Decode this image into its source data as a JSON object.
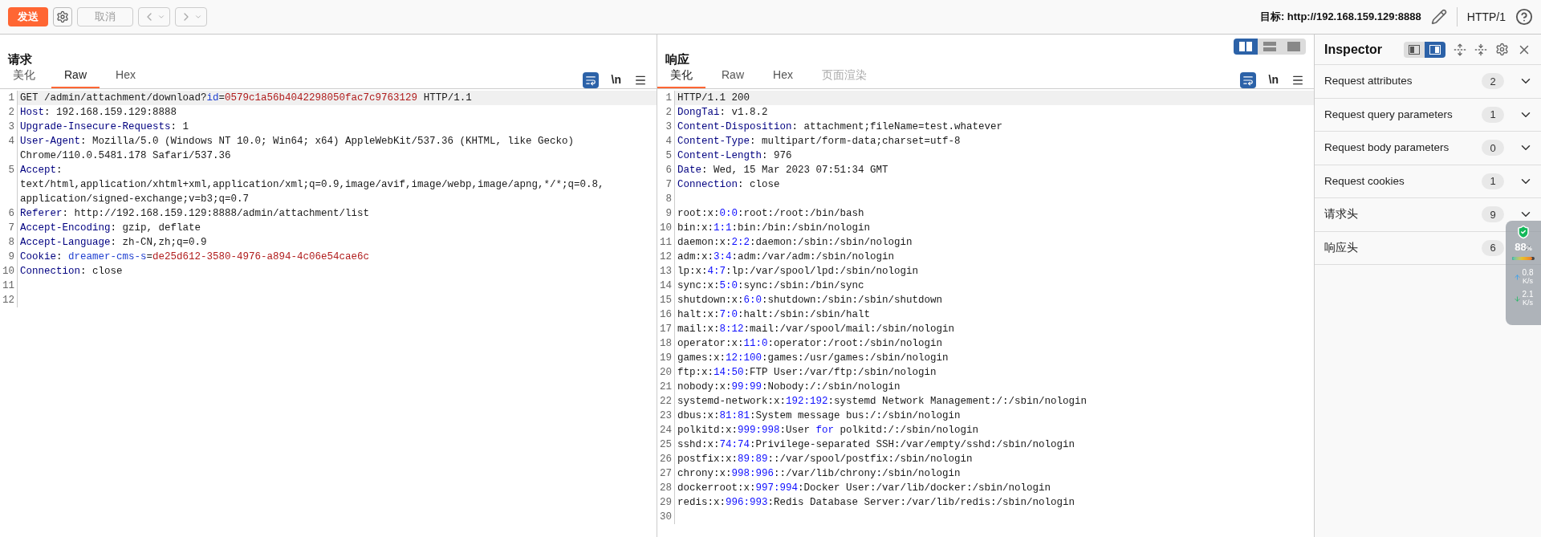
{
  "toolbar": {
    "send": "发送",
    "cancel": "取消",
    "target_label": "目标: ",
    "target_url": "http://192.168.159.129:8888",
    "protocol": "HTTP/1"
  },
  "layout_modes": [
    {
      "kind": "columns",
      "selected": true
    },
    {
      "kind": "rows",
      "selected": false
    },
    {
      "kind": "single",
      "selected": false
    }
  ],
  "request": {
    "title": "请求",
    "newline_toggle": "\\n",
    "tabs": [
      {
        "label": "美化",
        "selected": false,
        "disabled": false
      },
      {
        "label": "Raw",
        "selected": true,
        "disabled": false
      },
      {
        "label": "Hex",
        "selected": false,
        "disabled": false
      }
    ],
    "lines": [
      {
        "number": "1",
        "current": true,
        "parts": [
          {
            "kind": "text",
            "text": "GET /admin/attachment/download?"
          },
          {
            "kind": "param",
            "text": "id"
          },
          {
            "kind": "text",
            "text": "="
          },
          {
            "kind": "value",
            "text": "0579c1a56b4042298050fac7c9763129"
          },
          {
            "kind": "text",
            "text": " HTTP/1.1"
          }
        ]
      },
      {
        "number": "2",
        "current": false,
        "parts": [
          {
            "kind": "header",
            "text": "Host"
          },
          {
            "kind": "text",
            "text": ": 192.168.159.129:8888"
          }
        ]
      },
      {
        "number": "3",
        "current": false,
        "parts": [
          {
            "kind": "header",
            "text": "Upgrade-Insecure-Requests"
          },
          {
            "kind": "text",
            "text": ": 1"
          }
        ]
      },
      {
        "number": "4",
        "current": false,
        "parts": [
          {
            "kind": "header",
            "text": "User-Agent"
          },
          {
            "kind": "text",
            "text": ": Mozilla/5.0 (Windows NT 10.0; Win64; x64) AppleWebKit/537.36 (KHTML, like Gecko)"
          }
        ]
      },
      {
        "current": false,
        "parts": [
          {
            "kind": "text",
            "text": "Chrome/110.0.5481.178 Safari/537.36"
          }
        ]
      },
      {
        "number": "5",
        "current": false,
        "parts": [
          {
            "kind": "header",
            "text": "Accept"
          },
          {
            "kind": "text",
            "text": ":"
          }
        ]
      },
      {
        "current": false,
        "parts": [
          {
            "kind": "text",
            "text": "text/html,application/xhtml+xml,application/xml;q=0.9,image/avif,image/webp,image/apng,*/*;q=0.8,"
          }
        ]
      },
      {
        "current": false,
        "parts": [
          {
            "kind": "text",
            "text": "application/signed-exchange;v=b3;q=0.7"
          }
        ]
      },
      {
        "number": "6",
        "current": false,
        "parts": [
          {
            "kind": "header",
            "text": "Referer"
          },
          {
            "kind": "text",
            "text": ": http://192.168.159.129:8888/admin/attachment/list"
          }
        ]
      },
      {
        "number": "7",
        "current": false,
        "parts": [
          {
            "kind": "header",
            "text": "Accept-Encoding"
          },
          {
            "kind": "text",
            "text": ": gzip, deflate"
          }
        ]
      },
      {
        "number": "8",
        "current": false,
        "parts": [
          {
            "kind": "header",
            "text": "Accept-Language"
          },
          {
            "kind": "text",
            "text": ": zh-CN,zh;q=0.9"
          }
        ]
      },
      {
        "number": "9",
        "current": false,
        "parts": [
          {
            "kind": "header",
            "text": "Cookie"
          },
          {
            "kind": "text",
            "text": ": "
          },
          {
            "kind": "param",
            "text": "dreamer-cms-s"
          },
          {
            "kind": "text",
            "text": "="
          },
          {
            "kind": "value",
            "text": "de25d612-3580-4976-a894-4c06e54cae6c"
          }
        ]
      },
      {
        "number": "10",
        "current": false,
        "parts": [
          {
            "kind": "header",
            "text": "Connection"
          },
          {
            "kind": "text",
            "text": ": close"
          }
        ]
      },
      {
        "number": "11",
        "current": false
      },
      {
        "number": "12",
        "current": false
      }
    ]
  },
  "response": {
    "title": "响应",
    "newline_toggle": "\\n",
    "tabs": [
      {
        "label": "美化",
        "selected": true,
        "disabled": false
      },
      {
        "label": "Raw",
        "selected": false,
        "disabled": false
      },
      {
        "label": "Hex",
        "selected": false,
        "disabled": false
      },
      {
        "label": "页面渲染",
        "selected": false,
        "disabled": true
      }
    ],
    "lines": [
      {
        "number": "1",
        "current": true,
        "parts": [
          {
            "kind": "text",
            "text": "HTTP/1.1 200"
          }
        ]
      },
      {
        "number": "2",
        "current": false,
        "parts": [
          {
            "kind": "header",
            "text": "DongTai"
          },
          {
            "kind": "text",
            "text": ": v1.8.2"
          }
        ]
      },
      {
        "number": "3",
        "current": false,
        "parts": [
          {
            "kind": "header",
            "text": "Content-Disposition"
          },
          {
            "kind": "text",
            "text": ": attachment;fileName=test.whatever"
          }
        ]
      },
      {
        "number": "4",
        "current": false,
        "parts": [
          {
            "kind": "header",
            "text": "Content-Type"
          },
          {
            "kind": "text",
            "text": ": multipart/form-data;charset=utf-8"
          }
        ]
      },
      {
        "number": "5",
        "current": false,
        "parts": [
          {
            "kind": "header",
            "text": "Content-Length"
          },
          {
            "kind": "text",
            "text": ": 976"
          }
        ]
      },
      {
        "number": "6",
        "current": false,
        "parts": [
          {
            "kind": "header",
            "text": "Date"
          },
          {
            "kind": "text",
            "text": ": Wed, 15 Mar 2023 07:51:34 GMT"
          }
        ]
      },
      {
        "number": "7",
        "current": false,
        "parts": [
          {
            "kind": "header",
            "text": "Connection"
          },
          {
            "kind": "text",
            "text": ": close"
          }
        ]
      },
      {
        "number": "8",
        "current": false
      },
      {
        "number": "9",
        "current": false,
        "parts": [
          {
            "kind": "text",
            "text": "root:x:"
          },
          {
            "kind": "number",
            "text": "0:0"
          },
          {
            "kind": "text",
            "text": ":root:/root:/bin/bash"
          }
        ]
      },
      {
        "number": "10",
        "current": false,
        "parts": [
          {
            "kind": "text",
            "text": "bin:x:"
          },
          {
            "kind": "number",
            "text": "1:1"
          },
          {
            "kind": "text",
            "text": ":bin:/bin:/sbin/nologin"
          }
        ]
      },
      {
        "number": "11",
        "current": false,
        "parts": [
          {
            "kind": "text",
            "text": "daemon:x:"
          },
          {
            "kind": "number",
            "text": "2:2"
          },
          {
            "kind": "text",
            "text": ":daemon:/sbin:/sbin/nologin"
          }
        ]
      },
      {
        "number": "12",
        "current": false,
        "parts": [
          {
            "kind": "text",
            "text": "adm:x:"
          },
          {
            "kind": "number",
            "text": "3:4"
          },
          {
            "kind": "text",
            "text": ":adm:/var/adm:/sbin/nologin"
          }
        ]
      },
      {
        "number": "13",
        "current": false,
        "parts": [
          {
            "kind": "text",
            "text": "lp:x:"
          },
          {
            "kind": "number",
            "text": "4:7"
          },
          {
            "kind": "text",
            "text": ":lp:/var/spool/lpd:/sbin/nologin"
          }
        ]
      },
      {
        "number": "14",
        "current": false,
        "parts": [
          {
            "kind": "text",
            "text": "sync:x:"
          },
          {
            "kind": "number",
            "text": "5:0"
          },
          {
            "kind": "text",
            "text": ":sync:/sbin:/bin/sync"
          }
        ]
      },
      {
        "number": "15",
        "current": false,
        "parts": [
          {
            "kind": "text",
            "text": "shutdown:x:"
          },
          {
            "kind": "number",
            "text": "6:0"
          },
          {
            "kind": "text",
            "text": ":shutdown:/sbin:/sbin/shutdown"
          }
        ]
      },
      {
        "number": "16",
        "current": false,
        "parts": [
          {
            "kind": "text",
            "text": "halt:x:"
          },
          {
            "kind": "number",
            "text": "7:0"
          },
          {
            "kind": "text",
            "text": ":halt:/sbin:/sbin/halt"
          }
        ]
      },
      {
        "number": "17",
        "current": false,
        "parts": [
          {
            "kind": "text",
            "text": "mail:x:"
          },
          {
            "kind": "number",
            "text": "8:12"
          },
          {
            "kind": "text",
            "text": ":mail:/var/spool/mail:/sbin/nologin"
          }
        ]
      },
      {
        "number": "18",
        "current": false,
        "parts": [
          {
            "kind": "text",
            "text": "operator:x:"
          },
          {
            "kind": "number",
            "text": "11:0"
          },
          {
            "kind": "text",
            "text": ":operator:/root:/sbin/nologin"
          }
        ]
      },
      {
        "number": "19",
        "current": false,
        "parts": [
          {
            "kind": "text",
            "text": "games:x:"
          },
          {
            "kind": "number",
            "text": "12:100"
          },
          {
            "kind": "text",
            "text": ":games:/usr/games:/sbin/nologin"
          }
        ]
      },
      {
        "number": "20",
        "current": false,
        "parts": [
          {
            "kind": "text",
            "text": "ftp:x:"
          },
          {
            "kind": "number",
            "text": "14:50"
          },
          {
            "kind": "text",
            "text": ":FTP User:/var/ftp:/sbin/nologin"
          }
        ]
      },
      {
        "number": "21",
        "current": false,
        "parts": [
          {
            "kind": "text",
            "text": "nobody:x:"
          },
          {
            "kind": "number",
            "text": "99:99"
          },
          {
            "kind": "text",
            "text": ":Nobody:/:/sbin/nologin"
          }
        ]
      },
      {
        "number": "22",
        "current": false,
        "parts": [
          {
            "kind": "text",
            "text": "systemd-network:x:"
          },
          {
            "kind": "number",
            "text": "192:192"
          },
          {
            "kind": "text",
            "text": ":systemd Network Management:/:/sbin/nologin"
          }
        ]
      },
      {
        "number": "23",
        "current": false,
        "parts": [
          {
            "kind": "text",
            "text": "dbus:x:"
          },
          {
            "kind": "number",
            "text": "81:81"
          },
          {
            "kind": "text",
            "text": ":System message bus:/:/sbin/nologin"
          }
        ]
      },
      {
        "number": "24",
        "current": false,
        "parts": [
          {
            "kind": "text",
            "text": "polkitd:x:"
          },
          {
            "kind": "number",
            "text": "999:998"
          },
          {
            "kind": "text",
            "text": ":User "
          },
          {
            "kind": "keyword",
            "text": "for"
          },
          {
            "kind": "text",
            "text": " polkitd:/:/sbin/nologin"
          }
        ]
      },
      {
        "number": "25",
        "current": false,
        "parts": [
          {
            "kind": "text",
            "text": "sshd:x:"
          },
          {
            "kind": "number",
            "text": "74:74"
          },
          {
            "kind": "text",
            "text": ":Privilege-separated SSH:/var/empty/sshd:/sbin/nologin"
          }
        ]
      },
      {
        "number": "26",
        "current": false,
        "parts": [
          {
            "kind": "text",
            "text": "postfix:x:"
          },
          {
            "kind": "number",
            "text": "89:89"
          },
          {
            "kind": "text",
            "text": "::/var/spool/postfix:/sbin/nologin"
          }
        ]
      },
      {
        "number": "27",
        "current": false,
        "parts": [
          {
            "kind": "text",
            "text": "chrony:x:"
          },
          {
            "kind": "number",
            "text": "998:996"
          },
          {
            "kind": "text",
            "text": "::/var/lib/chrony:/sbin/nologin"
          }
        ]
      },
      {
        "number": "28",
        "current": false,
        "parts": [
          {
            "kind": "text",
            "text": "dockerroot:x:"
          },
          {
            "kind": "number",
            "text": "997:994"
          },
          {
            "kind": "text",
            "text": ":Docker User:/var/lib/docker:/sbin/nologin"
          }
        ]
      },
      {
        "number": "29",
        "current": false,
        "parts": [
          {
            "kind": "text",
            "text": "redis:x:"
          },
          {
            "kind": "number",
            "text": "996:993"
          },
          {
            "kind": "text",
            "text": ":Redis Database Server:/var/lib/redis:/sbin/nologin"
          }
        ]
      },
      {
        "number": "30",
        "current": false
      }
    ]
  },
  "inspector": {
    "title": "Inspector",
    "view_modes": [
      {
        "kind": "left",
        "selected": false
      },
      {
        "kind": "right",
        "selected": true
      }
    ],
    "sections": [
      {
        "label": "Request attributes",
        "count": "2"
      },
      {
        "label": "Request query parameters",
        "count": "1"
      },
      {
        "label": "Request body parameters",
        "count": "0"
      },
      {
        "label": "Request cookies",
        "count": "1"
      },
      {
        "label": "请求头",
        "count": "9"
      },
      {
        "label": "响应头",
        "count": "6"
      }
    ]
  },
  "monitor": {
    "percent": "88",
    "percent_unit": "%",
    "level": 0.88,
    "upload": "0.8",
    "upload_unit": "K/s",
    "download": "2.1",
    "download_unit": "K/s"
  }
}
